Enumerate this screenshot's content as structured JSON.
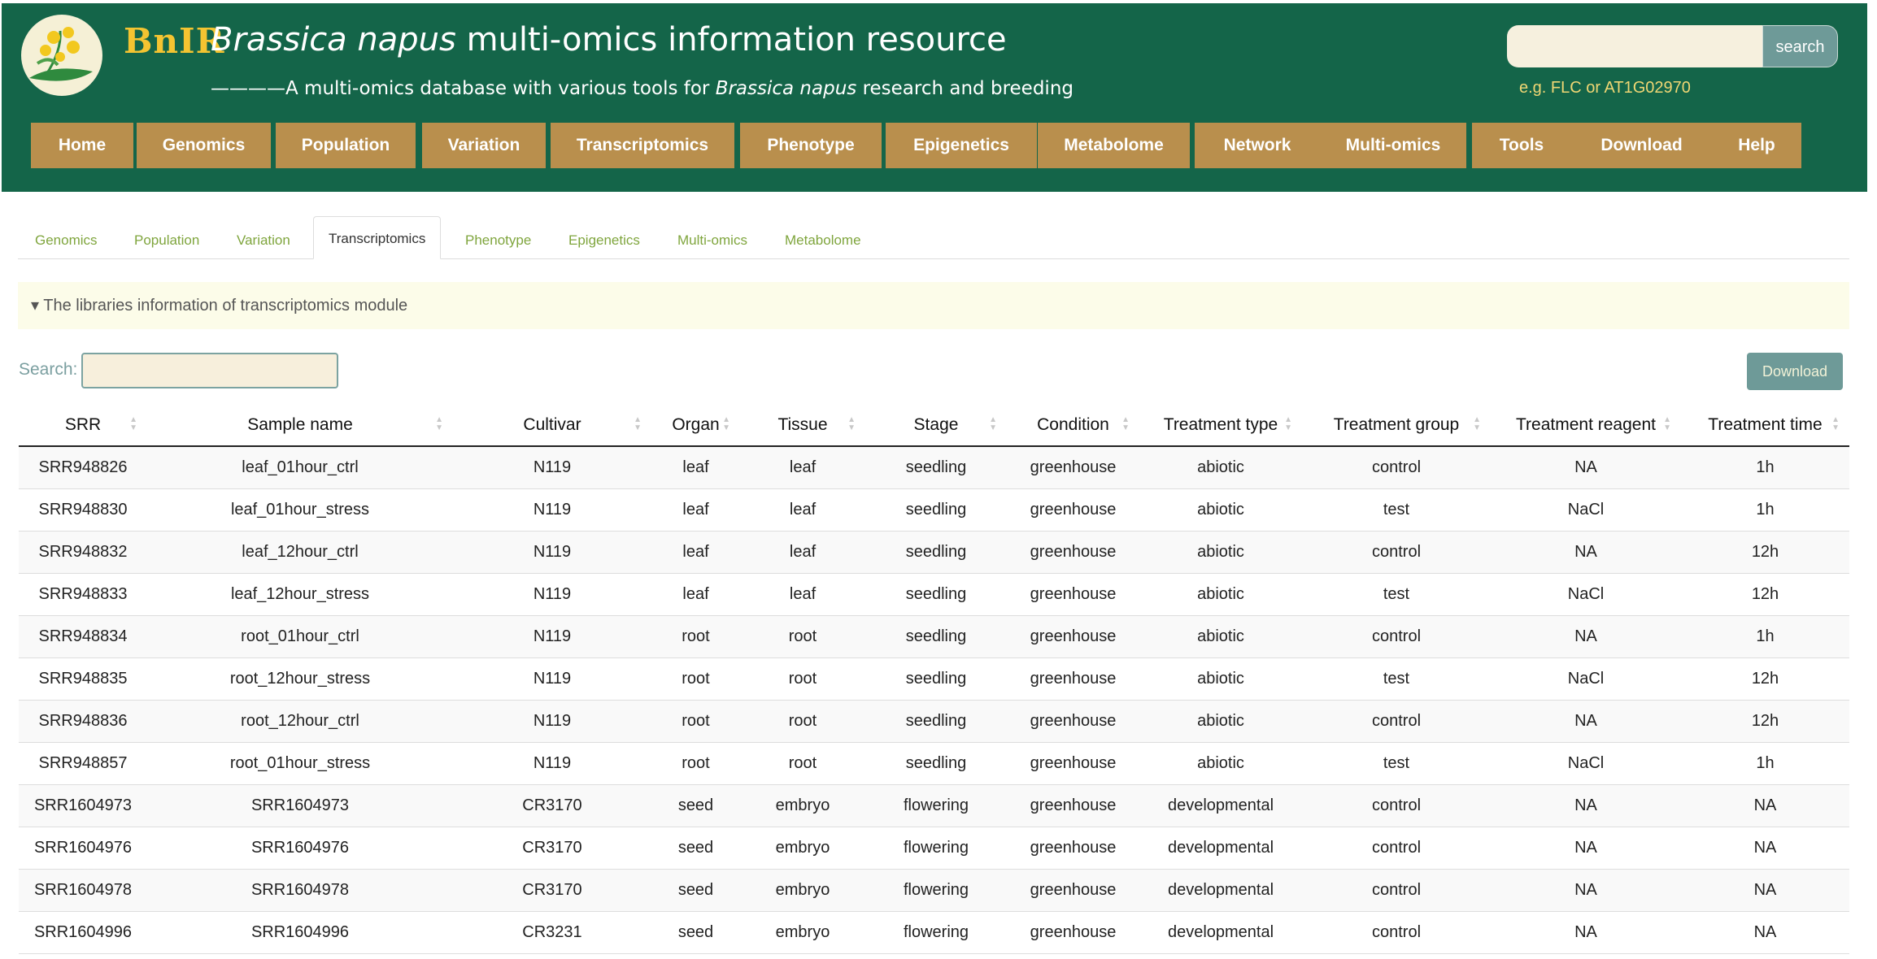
{
  "header": {
    "brand": "BnIR",
    "title_italic": "Brassica napus",
    "title_rest": " multi-omics information resource",
    "subtitle_prefix": "————A multi-omics database with various tools for ",
    "subtitle_italic": "Brassica napus",
    "subtitle_suffix": " research and breeding",
    "search_button": "search",
    "search_hint": "e.g. FLC or AT1G02970"
  },
  "nav": [
    "Home",
    "Genomics",
    "Population",
    "Variation",
    "Transcriptomics",
    "Phenotype",
    "Epigenetics",
    "Metabolome",
    "Network",
    "Multi-omics",
    "Tools",
    "Download",
    "Help"
  ],
  "tabs": [
    "Genomics",
    "Population",
    "Variation",
    "Transcriptomics",
    "Phenotype",
    "Epigenetics",
    "Multi-omics",
    "Metabolome"
  ],
  "active_tab": "Transcriptomics",
  "panel_title": "▾ The libraries information of transcriptomics module",
  "search_label": "Search:",
  "download_label": "Download",
  "table": {
    "columns": [
      "SRR",
      "Sample name",
      "Cultivar",
      "Organ",
      "Tissue",
      "Stage",
      "Condition",
      "Treatment type",
      "Treatment group",
      "Treatment reagent",
      "Treatment time"
    ],
    "rows": [
      [
        "SRR948826",
        "leaf_01hour_ctrl",
        "N119",
        "leaf",
        "leaf",
        "seedling",
        "greenhouse",
        "abiotic",
        "control",
        "NA",
        "1h"
      ],
      [
        "SRR948830",
        "leaf_01hour_stress",
        "N119",
        "leaf",
        "leaf",
        "seedling",
        "greenhouse",
        "abiotic",
        "test",
        "NaCl",
        "1h"
      ],
      [
        "SRR948832",
        "leaf_12hour_ctrl",
        "N119",
        "leaf",
        "leaf",
        "seedling",
        "greenhouse",
        "abiotic",
        "control",
        "NA",
        "12h"
      ],
      [
        "SRR948833",
        "leaf_12hour_stress",
        "N119",
        "leaf",
        "leaf",
        "seedling",
        "greenhouse",
        "abiotic",
        "test",
        "NaCl",
        "12h"
      ],
      [
        "SRR948834",
        "root_01hour_ctrl",
        "N119",
        "root",
        "root",
        "seedling",
        "greenhouse",
        "abiotic",
        "control",
        "NA",
        "1h"
      ],
      [
        "SRR948835",
        "root_12hour_stress",
        "N119",
        "root",
        "root",
        "seedling",
        "greenhouse",
        "abiotic",
        "test",
        "NaCl",
        "12h"
      ],
      [
        "SRR948836",
        "root_12hour_ctrl",
        "N119",
        "root",
        "root",
        "seedling",
        "greenhouse",
        "abiotic",
        "control",
        "NA",
        "12h"
      ],
      [
        "SRR948857",
        "root_01hour_stress",
        "N119",
        "root",
        "root",
        "seedling",
        "greenhouse",
        "abiotic",
        "test",
        "NaCl",
        "1h"
      ],
      [
        "SRR1604973",
        "SRR1604973",
        "CR3170",
        "seed",
        "embryo",
        "flowering",
        "greenhouse",
        "developmental",
        "control",
        "NA",
        "NA"
      ],
      [
        "SRR1604976",
        "SRR1604976",
        "CR3170",
        "seed",
        "embryo",
        "flowering",
        "greenhouse",
        "developmental",
        "control",
        "NA",
        "NA"
      ],
      [
        "SRR1604978",
        "SRR1604978",
        "CR3170",
        "seed",
        "embryo",
        "flowering",
        "greenhouse",
        "developmental",
        "control",
        "NA",
        "NA"
      ],
      [
        "SRR1604996",
        "SRR1604996",
        "CR3231",
        "seed",
        "embryo",
        "flowering",
        "greenhouse",
        "developmental",
        "control",
        "NA",
        "NA"
      ]
    ]
  },
  "colors": {
    "header_bg": "#146549",
    "nav_bg": "#b98f4d",
    "tab_text": "#7fa53d",
    "accent": "#6e9a98"
  }
}
